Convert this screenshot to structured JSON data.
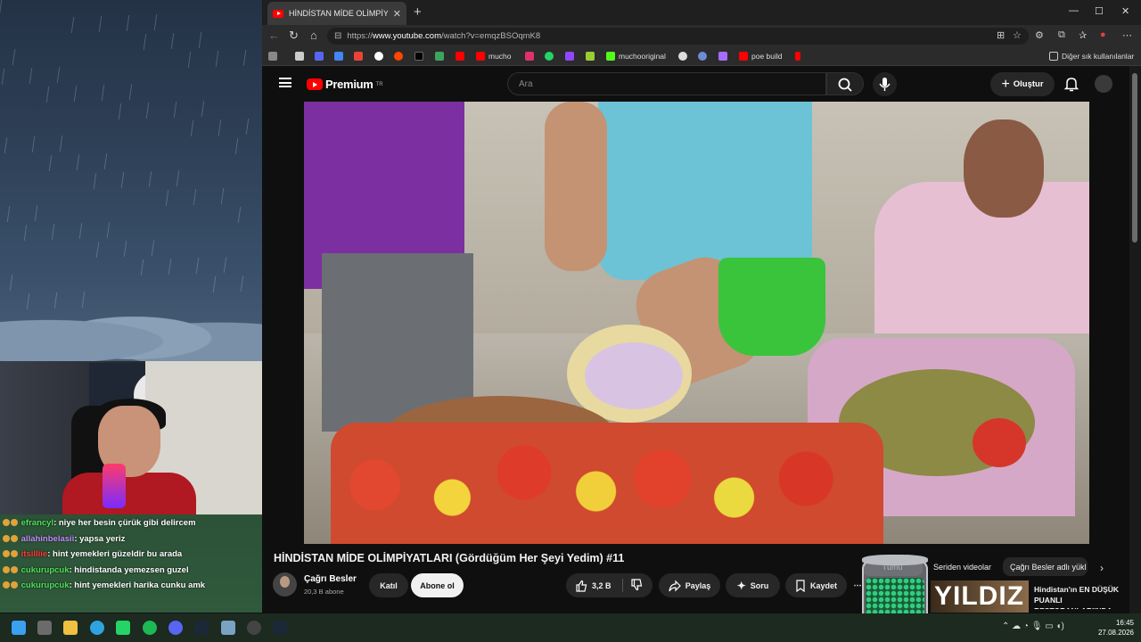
{
  "browser": {
    "tab_title": "HİNDİSTAN MİDE OLİMPİYATLARI",
    "url_prefix": "https://",
    "url_domain": "www.youtube.com",
    "url_path": "/watch?v=emqzBSOqmK8",
    "bookmarks": [
      "mucho",
      "muchooriginal",
      "poe build"
    ],
    "other_bookmarks": "Diğer sık kullanılanlar"
  },
  "youtube": {
    "logo_text": "Premium",
    "logo_sup": "TR",
    "search_placeholder": "Ara",
    "create_label": "Oluştur",
    "video_title": "HİNDİSTAN MİDE OLİMPİYATLARI (Gördüğüm Her Şeyi Yedim) #11",
    "channel_name": "Çağrı Besler",
    "subscribers": "20,3 B abone",
    "join_label": "Katıl",
    "subscribe_label": "Abone ol",
    "likes": "3,2 B",
    "share_label": "Paylaş",
    "ask_label": "Soru",
    "save_label": "Kaydet",
    "chips": [
      "Tümü",
      "Seriden videolar",
      "Çağrı Besler adlı yükl"
    ],
    "rec_thumb_text": "YILDIZ",
    "rec_title": "Hindistan'ın EN DÜŞÜK PUANLI RESTORANLARI'NDA..."
  },
  "chat": [
    {
      "user": "efrancyl",
      "color": "#4fe05a",
      "message": ": niye her besin çürük gibi delircem"
    },
    {
      "user": "allahinbelasii",
      "color": "#c58cff",
      "message": ": yapsa yeriz"
    },
    {
      "user": "itsilliie",
      "color": "#ff3b3b",
      "message": ": hint yemekleri güzeldir bu arada"
    },
    {
      "user": "cukurupcuk",
      "color": "#4fe05a",
      "message": ": hindistanda yemezsen guzel"
    },
    {
      "user": "cukurupcuk",
      "color": "#4fe05a",
      "message": ": hint yemekleri harika cunku amk"
    }
  ],
  "taskbar": {
    "time": "16:45",
    "date": "27.08.2026"
  },
  "colors": {
    "youtube_red": "#ff0000",
    "subscribe_bg": "#f1f1f1"
  }
}
